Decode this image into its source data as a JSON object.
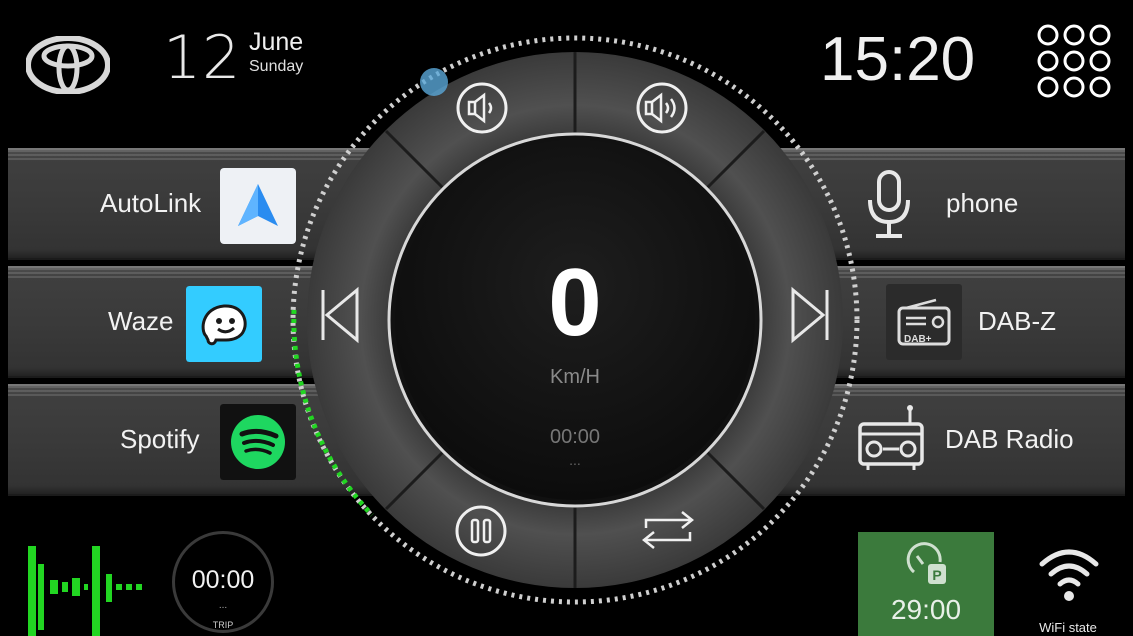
{
  "header": {
    "brand_icon": "toyota-logo-icon",
    "date_day": "12",
    "date_month": "June",
    "date_weekday": "Sunday",
    "clock": "15:20",
    "apps_icon": "app-grid-icon"
  },
  "left_apps": [
    {
      "label": "AutoLink",
      "icon": "autolink-icon"
    },
    {
      "label": "Waze",
      "icon": "waze-icon"
    },
    {
      "label": "Spotify",
      "icon": "spotify-icon"
    }
  ],
  "right_apps": [
    {
      "label": "phone",
      "icon": "microphone-icon"
    },
    {
      "label": "DAB-Z",
      "icon": "dab-radio-icon"
    },
    {
      "label": "DAB Radio",
      "icon": "radio-icon"
    }
  ],
  "dial": {
    "speed": "0",
    "speed_unit": "Km/H",
    "play_time": "00:00",
    "play_dots": "...",
    "dab_badge": "DAB+",
    "controls": [
      "volume-down-icon",
      "volume-up-icon",
      "previous-track-icon",
      "next-track-icon",
      "pause-icon",
      "repeat-icon"
    ]
  },
  "bottom": {
    "trip_time": "00:00",
    "trip_dots": "...",
    "trip_label": "TRIP",
    "parking_time": "29:00",
    "wifi_label": "WiFi state"
  },
  "colors": {
    "accent_green": "#22d622",
    "parking_bg": "#3b7a3c",
    "waze_blue": "#33ccff",
    "spotify_green": "#1ed760"
  }
}
